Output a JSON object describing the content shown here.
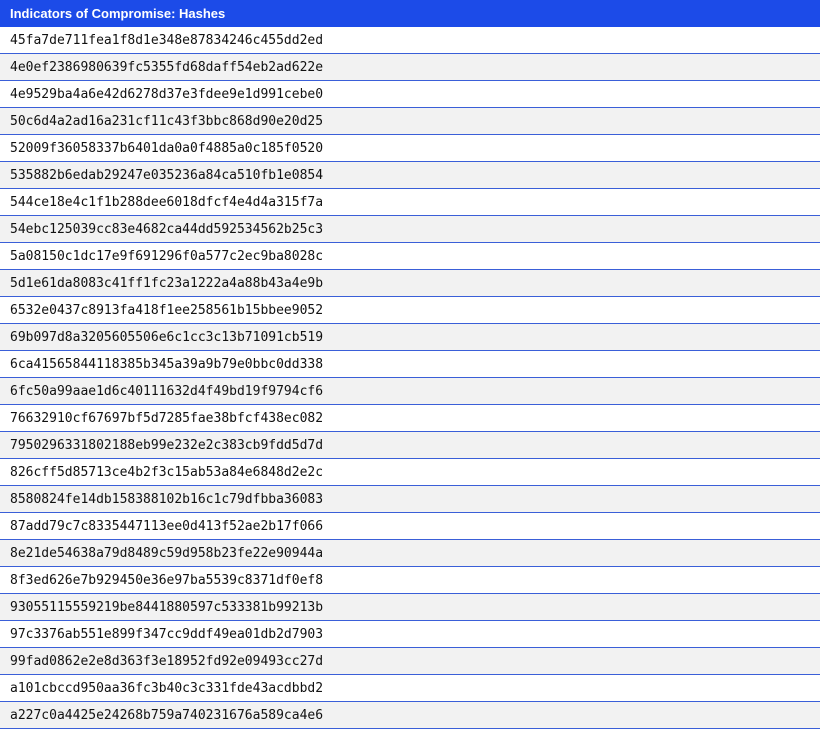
{
  "table": {
    "header": "Indicators of Compromise: Hashes",
    "rows": [
      "45fa7de711fea1f8d1e348e87834246c455dd2ed",
      "4e0ef2386980639fc5355fd68daff54eb2ad622e",
      "4e9529ba4a6e42d6278d37e3fdee9e1d991cebe0",
      "50c6d4a2ad16a231cf11c43f3bbc868d90e20d25",
      "52009f36058337b6401da0a0f4885a0c185f0520",
      "535882b6edab29247e035236a84ca510fb1e0854",
      "544ce18e4c1f1b288dee6018dfcf4e4d4a315f7a",
      "54ebc125039cc83e4682ca44dd592534562b25c3",
      "5a08150c1dc17e9f691296f0a577c2ec9ba8028c",
      "5d1e61da8083c41ff1fc23a1222a4a88b43a4e9b",
      "6532e0437c8913fa418f1ee258561b15bbee9052",
      "69b097d8a3205605506e6c1cc3c13b71091cb519",
      "6ca41565844118385b345a39a9b79e0bbc0dd338",
      "6fc50a99aae1d6c40111632d4f49bd19f9794cf6",
      "76632910cf67697bf5d7285fae38bfcf438ec082",
      "7950296331802188eb99e232e2c383cb9fdd5d7d",
      "826cff5d85713ce4b2f3c15ab53a84e6848d2e2c",
      "8580824fe14db158388102b16c1c79dfbba36083",
      "87add79c7c8335447113ee0d413f52ae2b17f066",
      "8e21de54638a79d8489c59d958b23fe22e90944a",
      "8f3ed626e7b929450e36e97ba5539c8371df0ef8",
      "93055115559219be8441880597c533381b99213b",
      "97c3376ab551e899f347cc9ddf49ea01db2d7903",
      "99fad0862e2e8d363f3e18952fd92e09493cc27d",
      "a101cbccd950aa36fc3b40c3c331fde43acdbbd2",
      "a227c0a4425e24268b759a740231676a589ca4e6"
    ]
  },
  "colors": {
    "header_background": "#1c4be8",
    "header_text": "#ffffff",
    "row_divider": "#3a5fd8",
    "row_alt_background": "#f2f2f2"
  }
}
